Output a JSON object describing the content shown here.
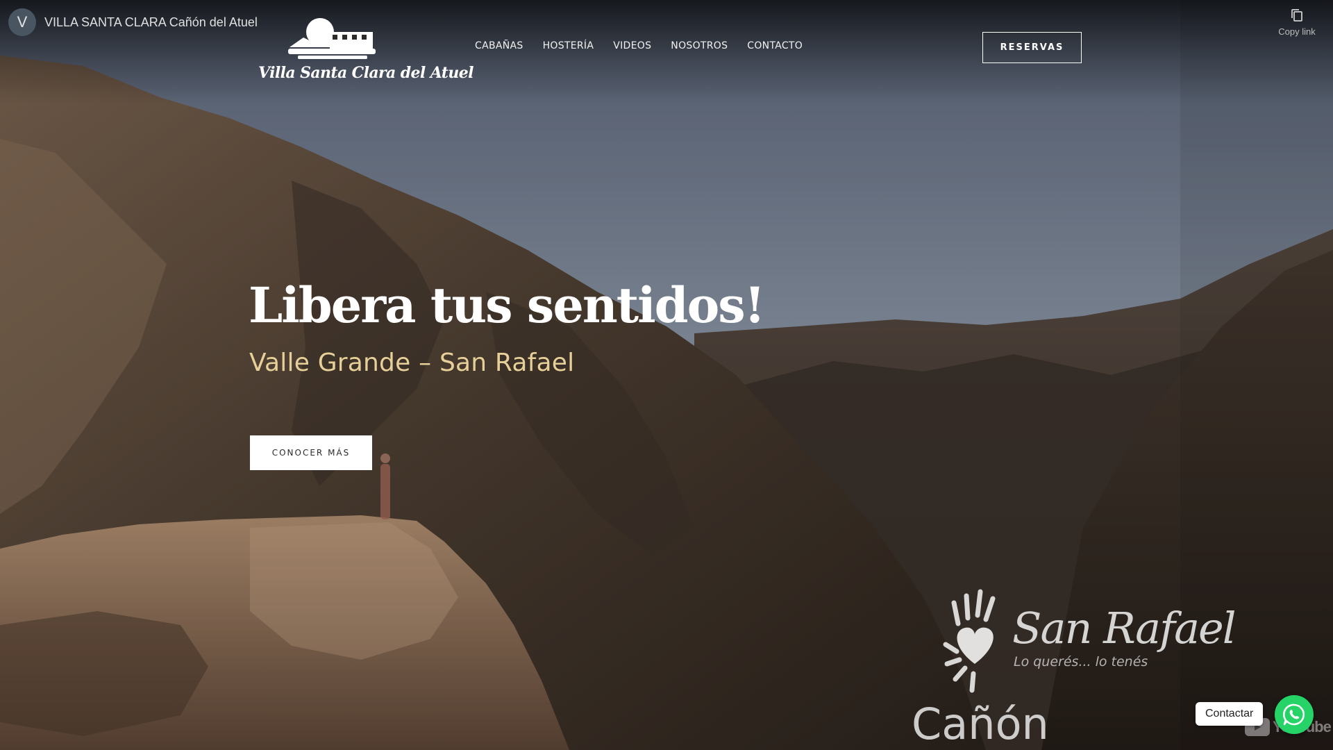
{
  "youtube": {
    "avatar_letter": "V",
    "channel_title": "VILLA SANTA CLARA Cañón del Atuel",
    "copy_link_label": "Copy link",
    "logo_text": "YouTube"
  },
  "header": {
    "logo_text": "Villa Santa Clara del Atuel",
    "nav": [
      {
        "label": "CABAÑAS"
      },
      {
        "label": "HOSTERÍA"
      },
      {
        "label": "VIDEOS"
      },
      {
        "label": "NOSOTROS"
      },
      {
        "label": "CONTACTO"
      }
    ],
    "reservas_label": "RESERVAS"
  },
  "hero": {
    "title": "Libera tus sentidos!",
    "subtitle": "Valle Grande – San Rafael",
    "cta_label": "CONOCER MÁS"
  },
  "video_overlay": {
    "brand_name": "San Rafael",
    "brand_tagline": "Lo querés... lo tenés",
    "caption": "Cañón"
  },
  "contact_widget": {
    "label": "Contactar"
  },
  "colors": {
    "subtitle_gold": "#e6cf98",
    "whatsapp_green": "#25d366"
  }
}
